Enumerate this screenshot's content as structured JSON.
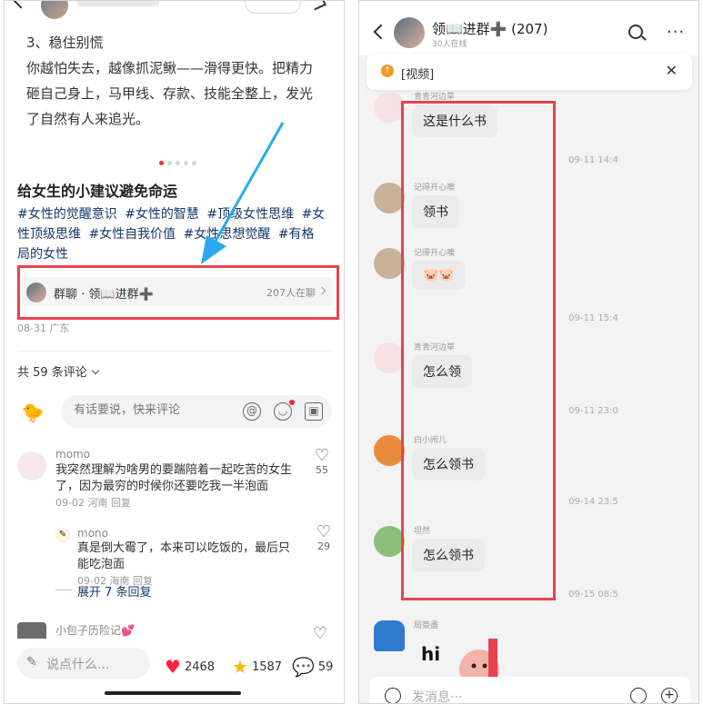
{
  "left": {
    "body_lines": [
      "3、稳住别慌",
      "你越怕失去，越像抓泥鳅——滑得更快。把精力",
      "砸自己身上，马甲线、存款、技能全整上，发光",
      "了自然有人来追光。"
    ],
    "post_title": "给女生的小建议避免命运",
    "tags": [
      "#女性的觉醒意识",
      "#女性的智慧",
      "#顶级女性思维",
      "#女性顶级思维",
      "#女性自我价值",
      "#女性思想觉醒",
      "#有格局的女性"
    ],
    "group_card": {
      "name": "群聊 · 领📖进群➕",
      "count": "207人在聊"
    },
    "date_loc": "08-31 广东",
    "comments_total": "共 59 条评论",
    "comment_input_placeholder": "有话要说，快来评论",
    "comments": [
      {
        "user": "momo",
        "text": "我突然理解为啥男的要踹陪着一起吃苦的女生了，因为最穷的时候你还要吃我一半泡面",
        "meta": "09-02 河南  回复",
        "likes": "55"
      }
    ],
    "reply": {
      "user": "mono",
      "text": "真是倒大霉了，本来可以吃饭的，最后只能吃泡面",
      "meta": "09-02 海南  回复",
      "likes": "29"
    },
    "expand_label": "展开 7 条回复",
    "third_user": "小包子历险记💕",
    "bottom": {
      "say_placeholder": "说点什么...",
      "likes": "2468",
      "stars": "1587",
      "comments": "59"
    }
  },
  "right": {
    "title": "领📖进群➕ (207)",
    "online": "30人在线",
    "pinned": "[视频]",
    "messages": [
      {
        "name": "青青河边草",
        "text": "这是什么书"
      },
      {
        "name": "记得开心噢",
        "text": "领书"
      },
      {
        "name": "记得开心噢",
        "text": "🐷🐷"
      },
      {
        "name": "青青河边草",
        "text": "怎么领"
      },
      {
        "name": "白小闹儿",
        "text": "怎么领书"
      },
      {
        "name": "坦然",
        "text": "怎么领书"
      },
      {
        "name": "局簽盡",
        "text": "hi"
      }
    ],
    "times": [
      "09-11 14:4",
      "09-11 15:4",
      "09-11 23:0",
      "09-14 23:5",
      "09-15 08:5"
    ],
    "input_placeholder": "发消息···"
  },
  "colors": {
    "highlight_red": "#e8424f",
    "arrow_blue": "#29a9f0",
    "tag_blue": "#13386c",
    "like_red": "#ff2442",
    "star_yellow": "#f7b500"
  }
}
